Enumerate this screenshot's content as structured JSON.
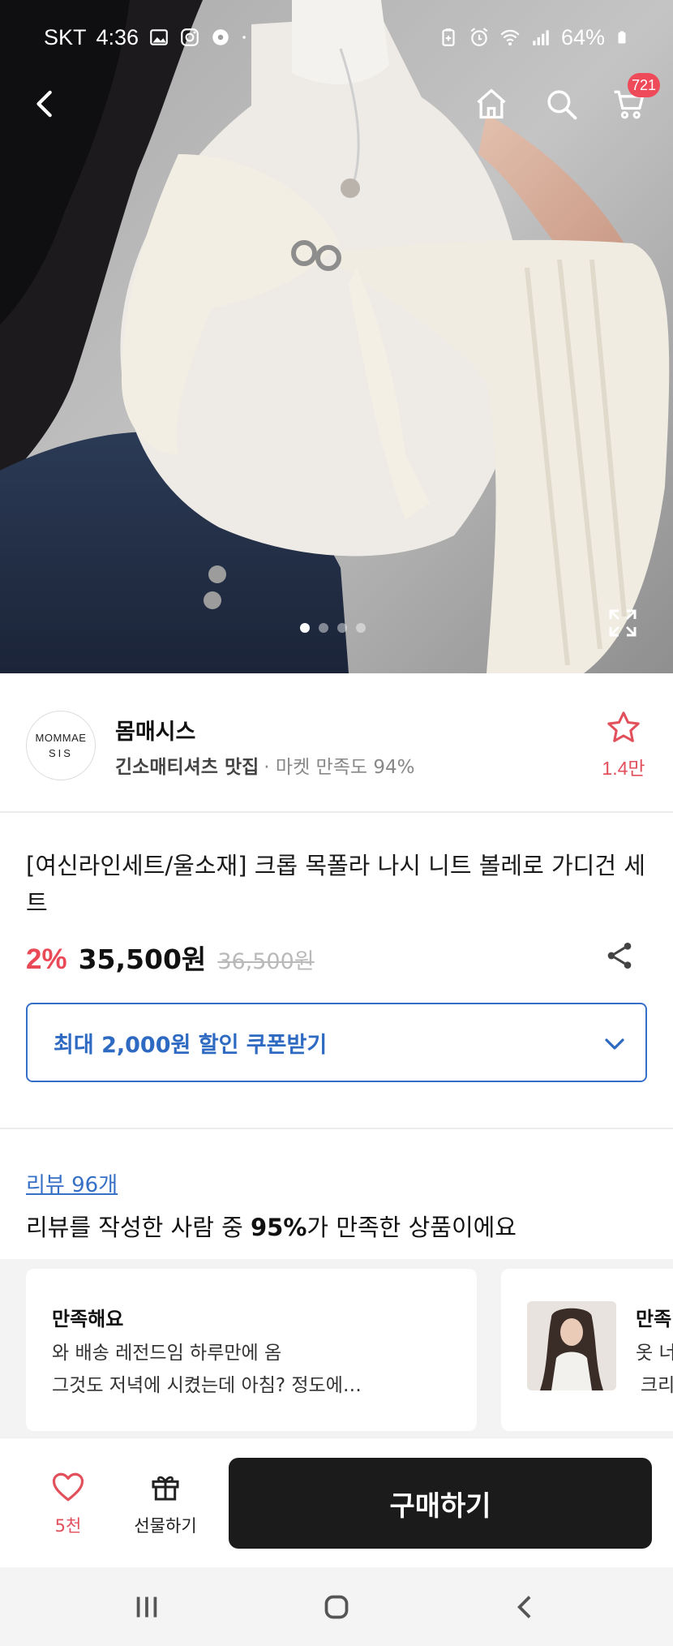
{
  "status_bar": {
    "carrier": "SKT",
    "time": "4:36",
    "battery": "64%",
    "icons_left": [
      "gallery-icon",
      "instagram-icon",
      "settings-badge-icon",
      "dot-icon"
    ],
    "icons_right": [
      "battery-saver-icon",
      "alarm-icon",
      "wifi-icon",
      "signal-icon",
      "battery-icon"
    ]
  },
  "nav": {
    "cart_badge": "721",
    "icons": [
      "back-icon",
      "home-icon",
      "search-icon",
      "cart-icon"
    ]
  },
  "carousel": {
    "slides": 4,
    "active_index": 0
  },
  "shop": {
    "logo_line1": "MOMMAE",
    "logo_line2": "SIS",
    "name": "몸매시스",
    "tag": "긴소매티셔츠 맛집",
    "satisfaction": "· 마켓 만족도 94%",
    "favorite_count": "1.4만"
  },
  "product": {
    "title": "[여신라인세트/울소재] 크롭 목폴라 나시 니트 볼레로 가디건 세트",
    "discount": "2%",
    "price": "35,500원",
    "original_price": "36,500원"
  },
  "coupon": {
    "label": "최대 2,000원 할인 쿠폰받기"
  },
  "reviews": {
    "link": "리뷰 96개",
    "summary_prefix": "리뷰를 작성한 사람 중 ",
    "summary_percent": "95%",
    "summary_suffix": "가 만족한 상품이에요",
    "cards": [
      {
        "title": "만족해요",
        "line1": "와 배송 레전드임 하루만에 옴",
        "line2": "그것도 저녁에 시켰는데 아침? 정도에…"
      },
      {
        "title": "만족",
        "line1": "옷 너",
        "line2": "크리"
      }
    ]
  },
  "actions": {
    "like_count": "5천",
    "gift_label": "선물하기",
    "buy_label": "구매하기"
  },
  "colors": {
    "accent_red": "#ea4a57",
    "coupon_blue": "#3670c6",
    "buy_button": "#1b1b1b"
  }
}
